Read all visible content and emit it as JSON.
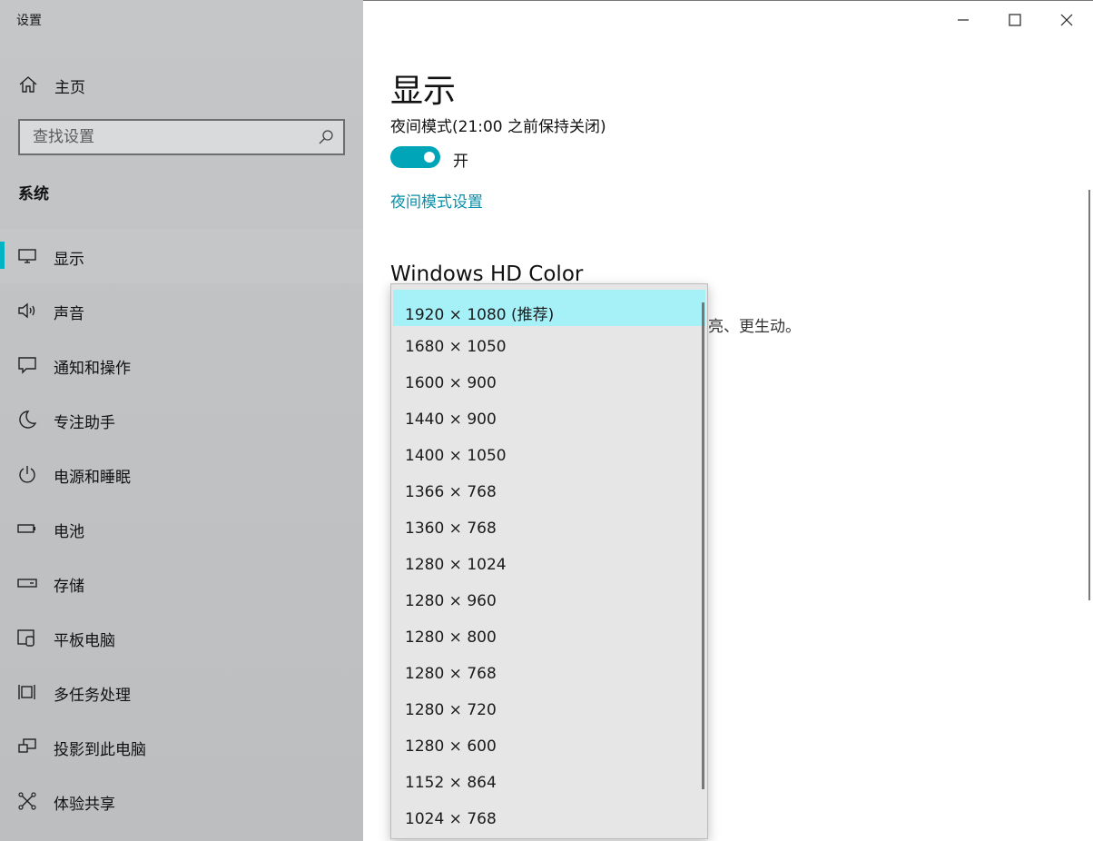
{
  "window": {
    "title": "设置"
  },
  "sidebar": {
    "home_label": "主页",
    "search_placeholder": "查找设置",
    "section_heading": "系统",
    "items": [
      {
        "label": "显示",
        "icon": "monitor-icon",
        "selected": true
      },
      {
        "label": "声音",
        "icon": "speaker-icon",
        "selected": false
      },
      {
        "label": "通知和操作",
        "icon": "notification-icon",
        "selected": false
      },
      {
        "label": "专注助手",
        "icon": "moon-icon",
        "selected": false
      },
      {
        "label": "电源和睡眠",
        "icon": "power-icon",
        "selected": false
      },
      {
        "label": "电池",
        "icon": "battery-icon",
        "selected": false
      },
      {
        "label": "存储",
        "icon": "storage-icon",
        "selected": false
      },
      {
        "label": "平板电脑",
        "icon": "tablet-icon",
        "selected": false
      },
      {
        "label": "多任务处理",
        "icon": "multitask-icon",
        "selected": false
      },
      {
        "label": "投影到此电脑",
        "icon": "project-icon",
        "selected": false
      },
      {
        "label": "体验共享",
        "icon": "share-icon",
        "selected": false
      }
    ]
  },
  "main": {
    "title": "显示",
    "night_light_label": "夜间模式(21:00 之前保持关闭)",
    "toggle_state": "开",
    "night_light_settings_link": "夜间模式设置",
    "hd_color_heading": "Windows HD Color",
    "hd_color_desc_visible": "亮、更生动。"
  },
  "resolution_dropdown": {
    "options": [
      {
        "label": "1920 × 1080 (推荐)",
        "selected": true
      },
      {
        "label": "1680 × 1050",
        "selected": false
      },
      {
        "label": "1600 × 900",
        "selected": false
      },
      {
        "label": "1440 × 900",
        "selected": false
      },
      {
        "label": "1400 × 1050",
        "selected": false
      },
      {
        "label": "1366 × 768",
        "selected": false
      },
      {
        "label": "1360 × 768",
        "selected": false
      },
      {
        "label": "1280 × 1024",
        "selected": false
      },
      {
        "label": "1280 × 960",
        "selected": false
      },
      {
        "label": "1280 × 800",
        "selected": false
      },
      {
        "label": "1280 × 768",
        "selected": false
      },
      {
        "label": "1280 × 720",
        "selected": false
      },
      {
        "label": "1280 × 600",
        "selected": false
      },
      {
        "label": "1152 × 864",
        "selected": false
      },
      {
        "label": "1024 × 768",
        "selected": false
      }
    ]
  },
  "colors": {
    "accent": "#00a6b8",
    "link": "#0a8fa8",
    "selected_option": "#a6f0f8"
  }
}
